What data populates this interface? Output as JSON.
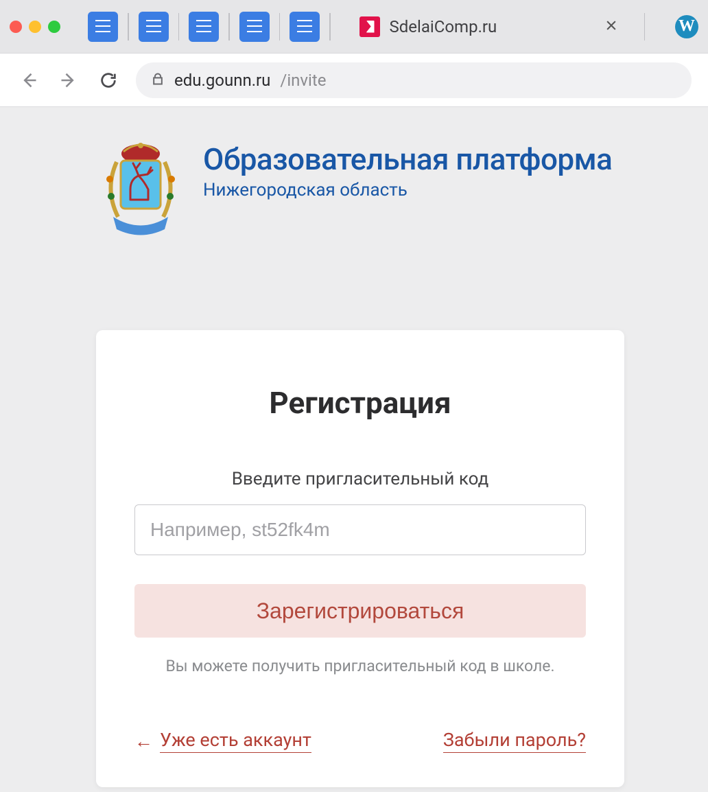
{
  "browser": {
    "active_tab_title": "SdelaiComp.ru",
    "url_domain": "edu.gounn.ru",
    "url_path": "/invite"
  },
  "brand": {
    "title": "Образовательная платформа",
    "subtitle": "Нижегородская область"
  },
  "form": {
    "heading": "Регистрация",
    "prompt": "Введите пригласительный код",
    "placeholder": "Например, st52fk4m",
    "submit_label": "Зарегистрироваться",
    "hint": "Вы можете получить пригласительный код в школе.",
    "back_arrow": "←",
    "back_label": "Уже есть аккаунт",
    "forgot_label": "Забыли пароль?"
  }
}
